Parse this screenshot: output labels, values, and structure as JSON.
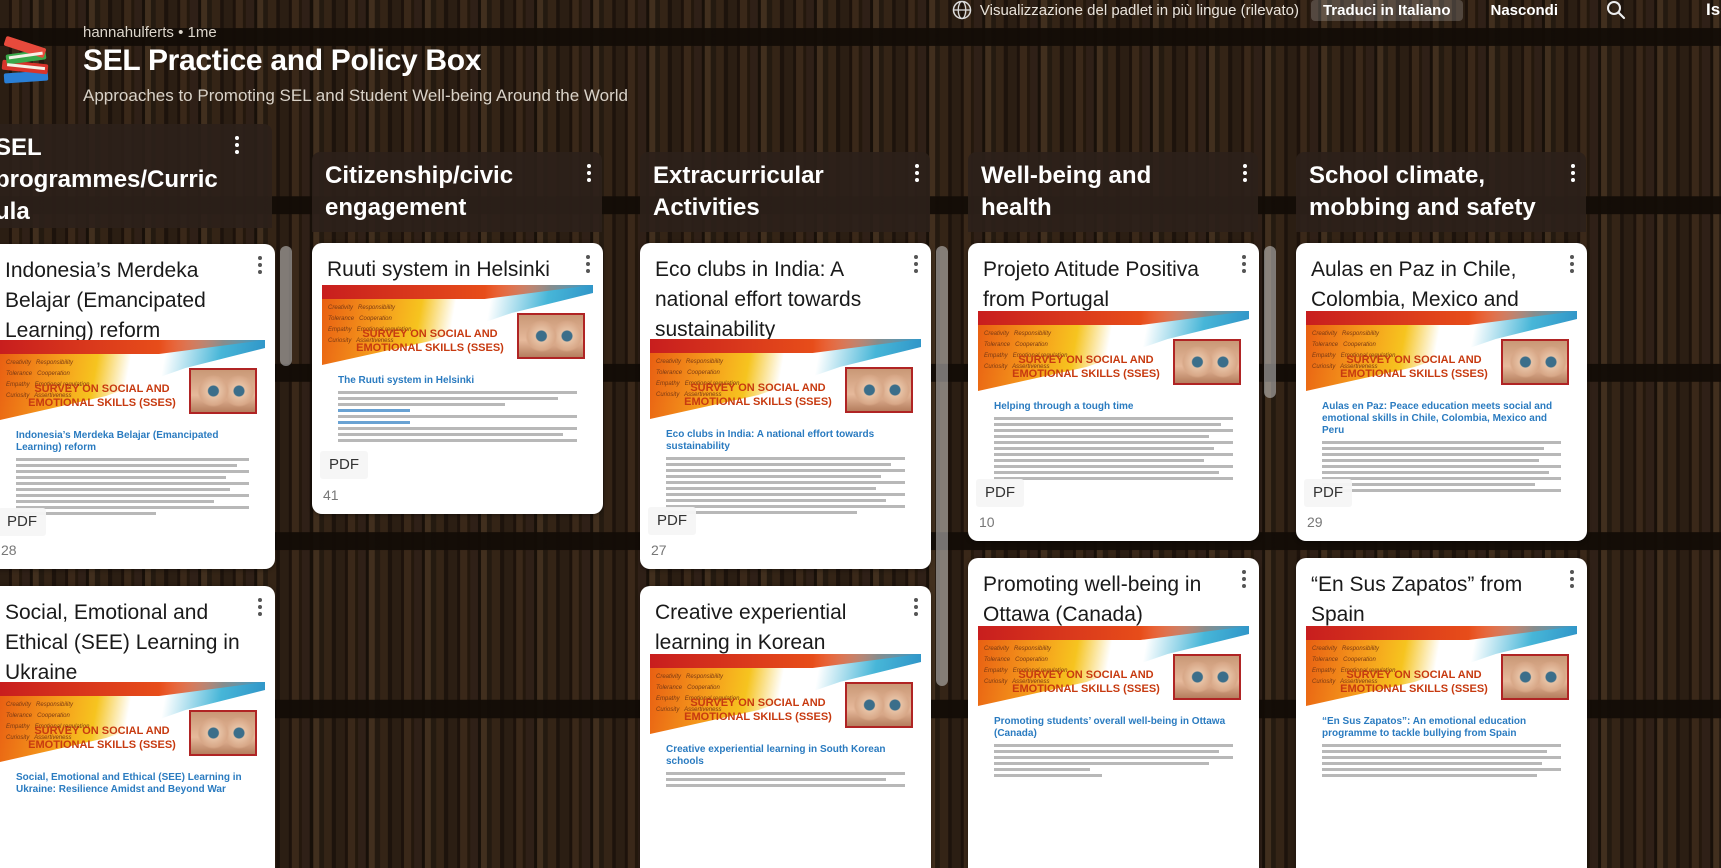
{
  "topbar": {
    "translation_notice": "Visualizzazione del padlet in più lingue (rilevato)",
    "translate_button": "Traduci in Italiano",
    "hide_button": "Nascondi",
    "signup_button": "Iscri"
  },
  "header": {
    "author": "hannahulferts • 1me",
    "title": "SEL Practice and Policy Box",
    "subtitle": "Approaches to Promoting SEL and Student Well-being Around the World"
  },
  "columns": [
    {
      "title": "SEL programmes/Curric ula",
      "cards": [
        {
          "title": "Indonesia’s Merdeka Belajar (Emancipated Learning) reform",
          "doc_title": "Indonesia’s Merdeka Belajar (Emancipated Learning) reform",
          "badge": "PDF",
          "count": "28"
        },
        {
          "title": "Social, Emotional and Ethical (SEE) Learning in Ukraine",
          "doc_title": "Social, Emotional and Ethical (SEE) Learning in Ukraine: Resilience Amidst and Beyond War",
          "badge": "",
          "count": ""
        }
      ]
    },
    {
      "title": "Citizenship/civic engagement",
      "cards": [
        {
          "title": "Ruuti system in Helsinki",
          "doc_title": "The Ruuti system in Helsinki",
          "badge": "PDF",
          "count": "41"
        }
      ]
    },
    {
      "title": "Extracurricular Activities",
      "cards": [
        {
          "title": "Eco clubs in India: A national effort towards sustainability",
          "doc_title": "Eco clubs in India: A national effort towards sustainability",
          "badge": "PDF",
          "count": "27"
        },
        {
          "title": "Creative experiential learning in Korean",
          "doc_title": "Creative experiential learning in South Korean schools",
          "badge": "",
          "count": ""
        }
      ]
    },
    {
      "title": "Well-being and health",
      "cards": [
        {
          "title": "Projeto Atitude Positiva from Portugal",
          "doc_title": "Helping through a tough time",
          "badge": "PDF",
          "count": "10"
        },
        {
          "title": "Promoting well-being in Ottawa (Canada)",
          "doc_title": "Promoting students’ overall well-being in Ottawa (Canada)",
          "badge": "",
          "count": ""
        }
      ]
    },
    {
      "title": "School climate, mobbing and safety",
      "cards": [
        {
          "title": "Aulas en Paz in Chile, Colombia, Mexico and Peru",
          "doc_title": "Aulas en Paz: Peace education meets social and emotional skills in Chile, Colombia, Mexico and Peru",
          "badge": "PDF",
          "count": "29"
        },
        {
          "title": "“En Sus Zapatos” from Spain",
          "doc_title": "“En Sus Zapatos”: An emotional education programme to tackle bullying from Spain",
          "badge": "",
          "count": ""
        }
      ]
    }
  ],
  "banner": {
    "survey_title": "SURVEY ON SOCIAL AND EMOTIONAL SKILLS (SSES)",
    "skill_words": [
      "Creativity",
      "Responsibility",
      "Tolerance",
      "Cooperation",
      "Empathy",
      "Emotional regulation",
      "Curiosity",
      "Assertiveness"
    ]
  }
}
